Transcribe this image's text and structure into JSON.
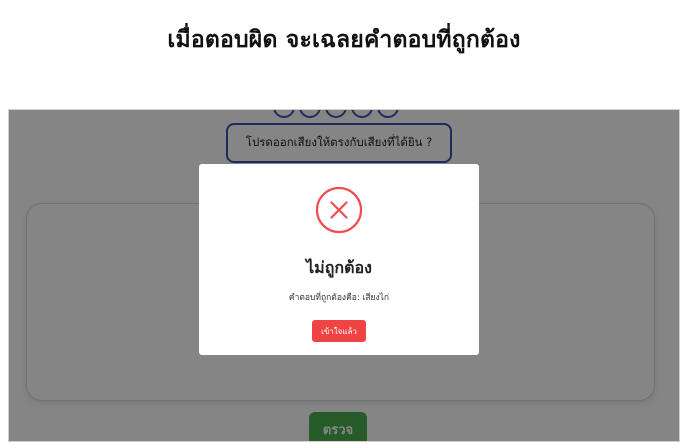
{
  "heading": "เมื่อตอบผิด จะเฉลยคำตอบที่ถูกต้อง",
  "quiz": {
    "prompt": "โปรดออกเสียงให้ตรงกับเสียงที่ได้ยิน ?",
    "check_label": "ตรวจ"
  },
  "modal": {
    "icon": "x-circle-icon",
    "title": "ไม่ถูกต้อง",
    "answer_text": "คำตอบที่ถูกต้องคือ: เสียงไก่",
    "button_label": "เข้าใจแล้ว"
  },
  "colors": {
    "accent_blue": "#3f51b5",
    "check_green": "#4caf50",
    "error_red": "#f04444"
  }
}
